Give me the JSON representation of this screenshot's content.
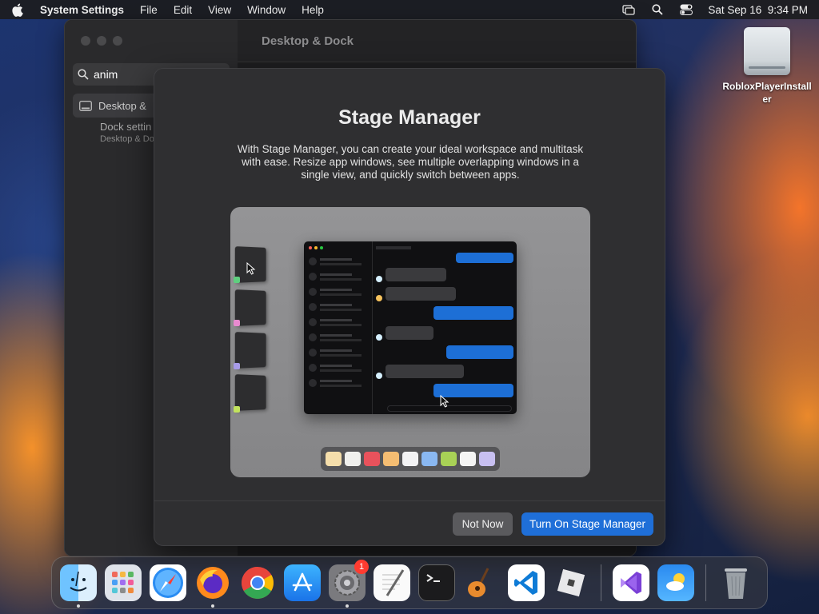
{
  "menubar": {
    "app_name": "System Settings",
    "menus": [
      "File",
      "Edit",
      "View",
      "Window",
      "Help"
    ],
    "datetime": "Sat Sep 16  9:34 PM"
  },
  "desktop": {
    "drive_label": "RobloxPlayerInstaller"
  },
  "settings": {
    "window_title": "Desktop & Dock",
    "search_value": "anim",
    "sidebar_item": "Desktop &",
    "result_title": "Dock settin",
    "result_subtitle": "Desktop & Do"
  },
  "sheet": {
    "title": "Stage Manager",
    "description": "With Stage Manager, you can create your ideal workspace and multitask with ease. Resize app windows, see multiple overlapping windows in a single view, and quickly switch between apps.",
    "secondary_button": "Not Now",
    "primary_button": "Turn On Stage Manager"
  },
  "dock": {
    "items": [
      "Finder",
      "Launchpad",
      "Safari",
      "Firefox",
      "Chrome",
      "App Store",
      "System Settings",
      "TextEdit",
      "Terminal",
      "GarageBand",
      "Visual Studio Code",
      "Roblox",
      "Visual Studio",
      "Weather",
      "Trash"
    ],
    "settings_badge": "1"
  },
  "colors": {
    "accent": "#1f6fd8",
    "sheet_bg": "#2f2f31"
  }
}
